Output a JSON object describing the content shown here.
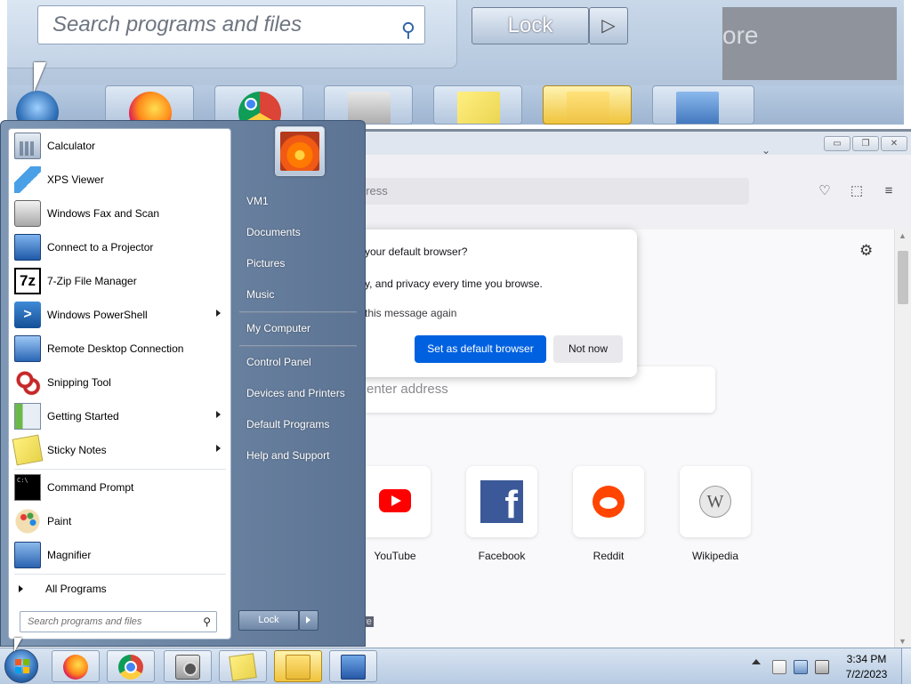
{
  "magnifier": {
    "search_placeholder": "Search programs and files",
    "lock_label": "Lock",
    "overflow_text": "ore"
  },
  "browser": {
    "address_placeholder": "dress",
    "search_placeholder": "enter address",
    "stories_label": "ore",
    "window_buttons": {
      "minimize": "▭",
      "restore": "❐",
      "close": "✕"
    },
    "top_sites": [
      {
        "label": "YouTube",
        "icon": "youtube-icon"
      },
      {
        "label": "Facebook",
        "icon": "facebook-icon"
      },
      {
        "label": "Reddit",
        "icon": "reddit-icon"
      },
      {
        "label": "Wikipedia",
        "icon": "wikipedia-icon"
      }
    ],
    "dialog": {
      "title": "your default browser?",
      "body": "y, and privacy every time you browse.",
      "checkbox_label": "this message again",
      "primary_button": "Set as default browser",
      "secondary_button": "Not now"
    }
  },
  "start_menu": {
    "programs": [
      {
        "label": "Calculator",
        "icon": "calculator-icon",
        "submenu": false
      },
      {
        "label": "XPS Viewer",
        "icon": "xps-viewer-icon",
        "submenu": false
      },
      {
        "label": "Windows Fax and Scan",
        "icon": "fax-scan-icon",
        "submenu": false
      },
      {
        "label": "Connect to a Projector",
        "icon": "projector-icon",
        "submenu": false
      },
      {
        "label": "7-Zip File Manager",
        "icon": "7zip-icon",
        "submenu": false
      },
      {
        "label": "Windows PowerShell",
        "icon": "powershell-icon",
        "submenu": true
      },
      {
        "label": "Remote Desktop Connection",
        "icon": "remote-desktop-icon",
        "submenu": false
      },
      {
        "label": "Snipping Tool",
        "icon": "snipping-tool-icon",
        "submenu": false
      },
      {
        "label": "Getting Started",
        "icon": "getting-started-icon",
        "submenu": true
      },
      {
        "label": "Sticky Notes",
        "icon": "sticky-notes-icon",
        "submenu": true
      }
    ],
    "pinned_bottom": [
      {
        "label": "Command Prompt",
        "icon": "command-prompt-icon"
      },
      {
        "label": "Paint",
        "icon": "paint-icon"
      },
      {
        "label": "Magnifier",
        "icon": "magnifier-icon"
      }
    ],
    "all_programs_label": "All Programs",
    "search_placeholder": "Search programs and files",
    "right_items": [
      "VM1",
      "Documents",
      "Pictures",
      "Music",
      "My Computer",
      "Control Panel",
      "Devices and Printers",
      "Default Programs",
      "Help and Support"
    ],
    "lock_label": "Lock"
  },
  "taskbar": {
    "apps": [
      {
        "name": "firefox",
        "icon": "firefox-icon",
        "active": false
      },
      {
        "name": "chrome",
        "icon": "chrome-icon",
        "active": false
      },
      {
        "name": "camera",
        "icon": "camera-app-icon",
        "active": false
      },
      {
        "name": "sticky-notes",
        "icon": "sticky-notes-icon",
        "active": false
      },
      {
        "name": "explorer",
        "icon": "file-explorer-icon",
        "active": true
      },
      {
        "name": "magnifier",
        "icon": "magnifier-icon",
        "active": false
      }
    ],
    "clock_time": "3:34 PM",
    "clock_date": "7/2/2023"
  }
}
